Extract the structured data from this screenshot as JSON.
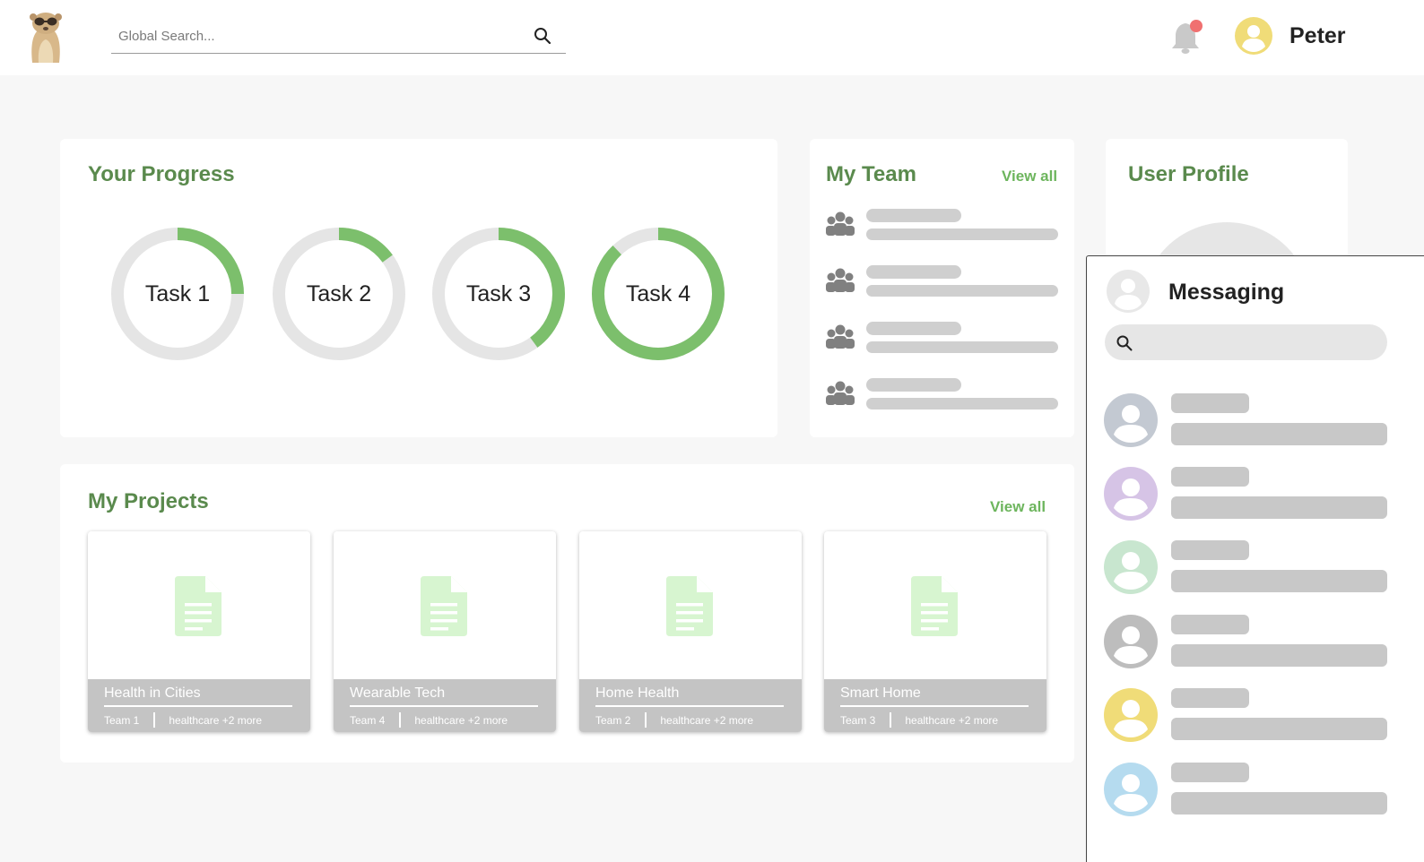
{
  "header": {
    "user_name": "Peter",
    "search_placeholder": "Global Search...",
    "notification_dot_color": "#f07070",
    "user_avatar_color": "#f0dc78"
  },
  "progress": {
    "title": "Your Progress",
    "accent_color": "#7cbf6c",
    "track_color": "#e5e5e5",
    "tasks": [
      {
        "label": "Task 1",
        "percent": 25
      },
      {
        "label": "Task 2",
        "percent": 15
      },
      {
        "label": "Task 3",
        "percent": 40
      },
      {
        "label": "Task 4",
        "percent": 88
      }
    ]
  },
  "team": {
    "title": "My Team",
    "view_all": "View all"
  },
  "profile": {
    "title": "User Profile"
  },
  "projects": {
    "title": "My Projects",
    "view_all": "View all",
    "items": [
      {
        "name": "Health in Cities",
        "team": "Team 1",
        "tags": "healthcare +2 more"
      },
      {
        "name": "Wearable Tech",
        "team": "Team 4",
        "tags": "healthcare +2 more"
      },
      {
        "name": "Home Health",
        "team": "Team 2",
        "tags": "healthcare +2 more"
      },
      {
        "name": "Smart Home",
        "team": "Team 3",
        "tags": "healthcare +2 more"
      }
    ]
  },
  "messaging": {
    "title": "Messaging",
    "search_placeholder": "",
    "contact_colors": [
      "#c3c9d2",
      "#d6c4e6",
      "#c8e6cf",
      "#bdbdbd",
      "#f0dc78",
      "#b5dbef"
    ]
  }
}
